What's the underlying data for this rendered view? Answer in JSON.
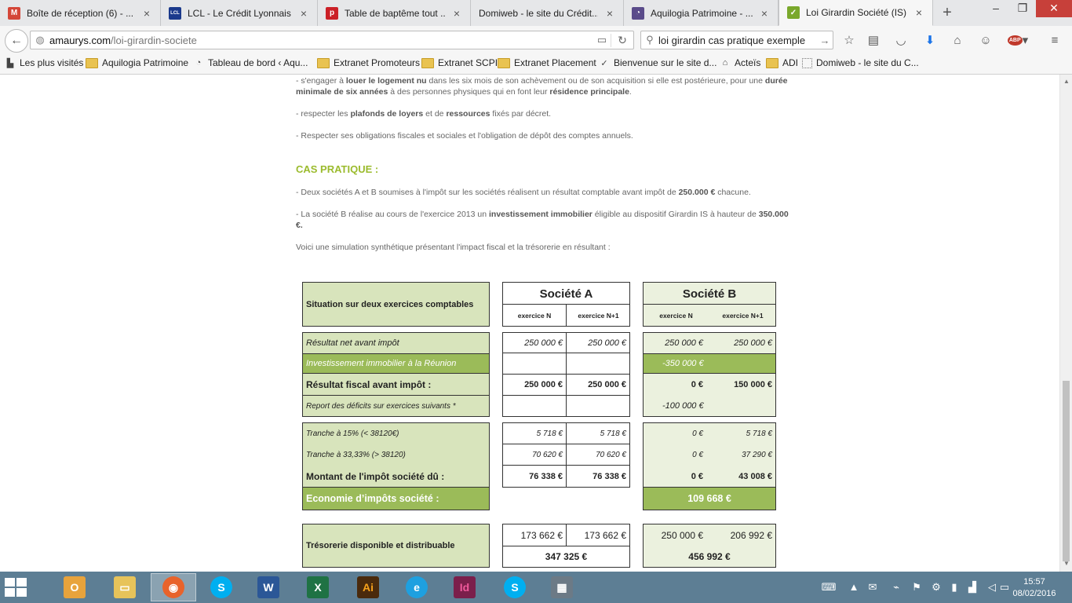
{
  "browser": {
    "tabs": [
      {
        "title": "Boîte de réception (6) - ...",
        "icon": "gmail-icon",
        "color": "#d44638",
        "glyph": "M"
      },
      {
        "title": "LCL - Le Crédit Lyonnais",
        "icon": "lcl-icon",
        "color": "#1b3a8c",
        "glyph": "LCL"
      },
      {
        "title": "Table de baptême tout ...",
        "icon": "pinterest-icon",
        "color": "#cb2027",
        "glyph": "p"
      },
      {
        "title": "Domiweb - le site du Crédit...",
        "icon": "",
        "color": "",
        "glyph": ""
      },
      {
        "title": "Aquilogia Patrimoine - ...",
        "icon": "aquilogia-icon",
        "color": "#5a4b8a",
        "glyph": "◔"
      },
      {
        "title": "Loi Girardin Société (IS)",
        "icon": "leaf-icon",
        "color": "#7aa82b",
        "glyph": "✓"
      }
    ],
    "url_host": "amaurys.com",
    "url_path": "/loi-girardin-societe",
    "search_value": "loi girardin cas pratique exemple",
    "bookmarks": [
      {
        "label": "Les plus visités",
        "icon": "bookmark-icon"
      },
      {
        "label": "Aquilogia Patrimoine",
        "icon": "folder-icon"
      },
      {
        "label": "Tableau de bord ‹ Aqu...",
        "icon": "aquilogia-icon"
      },
      {
        "label": "Extranet Promoteurs",
        "icon": "folder-icon"
      },
      {
        "label": "Extranet SCPI",
        "icon": "folder-icon"
      },
      {
        "label": "Extranet Placement",
        "icon": "folder-icon"
      },
      {
        "label": "Bienvenue sur le site d...",
        "icon": "check-icon"
      },
      {
        "label": "Acteïs",
        "icon": "acteis-icon"
      },
      {
        "label": "ADI",
        "icon": "folder-icon"
      },
      {
        "label": "Domiweb - le site du C...",
        "icon": "page-icon"
      }
    ]
  },
  "article": {
    "para1_pre": "- s'engager à ",
    "para1_b1": "louer le logement nu",
    "para1_mid": " dans les six mois de son achèvement ou de son acquisition si elle est postérieure, pour une ",
    "para1_b2": "durée minimale de six années",
    "para1_mid2": " à des personnes physiques qui en font leur ",
    "para1_b3": "résidence principale",
    "para1_end": ".",
    "para2_pre": "- respecter les ",
    "para2_b1": "plafonds de loyers",
    "para2_mid": " et de ",
    "para2_b2": "ressources",
    "para2_end": " fixés par décret.",
    "para3": "-  Respecter ses obligations fiscales et sociales et l'obligation de dépôt des comptes annuels.",
    "cas_title": "CAS PRATIQUE :",
    "para4_pre": "- Deux sociétés A et B soumises à l'impôt sur les sociétés réalisent un résultat comptable avant impôt de ",
    "para4_b": "250.000 €",
    "para4_end": " chacune.",
    "para5_pre": "- La société B réalise au cours de l'exercice 2013 un ",
    "para5_b1": "investissement immobilier",
    "para5_mid": " éligible au dispositif Girardin IS à hauteur de ",
    "para5_b2": "350.000 €.",
    "para6": "Voici une simulation synthétique présentant l'impact fiscal et la trésorerie en résultant :"
  },
  "table": {
    "header_label": "Situation sur deux exercices comptables",
    "societe_a": "Société A",
    "societe_b": "Société B",
    "ex_n": "exercice N",
    "ex_n1": "exercice N+1",
    "rows": {
      "resultat_net": {
        "label": "Résultat net avant impôt",
        "a_n": "250 000 €",
        "a_n1": "250 000 €",
        "b_n": "250 000 €",
        "b_n1": "250 000 €"
      },
      "investissement": {
        "label": "Investissement immobilier à la Réunion",
        "b": "-350 000 €"
      },
      "resultat_fiscal": {
        "label": "Résultat fiscal avant impôt :",
        "a_n": "250 000 €",
        "a_n1": "250 000 €",
        "b_n": "0 €",
        "b_n1": "150 000 €"
      },
      "report": {
        "label": "Report des déficits sur exercices suivants *",
        "b": "-100 000 €"
      },
      "tranche15": {
        "label": "Tranche à 15% (< 38120€)",
        "a_n": "5 718 €",
        "a_n1": "5 718 €",
        "b_n": "0 €",
        "b_n1": "5 718 €"
      },
      "tranche33": {
        "label": "Tranche à 33,33% (> 38120)",
        "a_n": "70 620 €",
        "a_n1": "70 620 €",
        "b_n": "0 €",
        "b_n1": "37 290 €"
      },
      "montant": {
        "label": "Montant de l'impôt société dû :",
        "a_n": "76 338 €",
        "a_n1": "76 338 €",
        "b_n": "0 €",
        "b_n1": "43 008 €"
      },
      "economie": {
        "label": "Economie d’impôts société :",
        "b": "109 668 €"
      },
      "tresorerie": {
        "label": "Trésorerie disponible et distribuable",
        "a_n": "173 662 €",
        "a_n1": "173 662 €",
        "a_total": "347 325 €",
        "b_n": "250 000 €",
        "b_n1": "206 992 €",
        "b_total": "456 992 €"
      }
    }
  },
  "taskbar": {
    "time": "15:57",
    "date": "08/02/2016",
    "apps": [
      {
        "name": "outlook-icon",
        "glyph": "O",
        "color": "#e8a33c"
      },
      {
        "name": "file-explorer-icon",
        "glyph": "▭",
        "color": "#e7c35a"
      },
      {
        "name": "firefox-icon",
        "glyph": "◉",
        "color": "#e8632b"
      },
      {
        "name": "skype-icon",
        "glyph": "S",
        "color": "#00aff0"
      },
      {
        "name": "word-icon",
        "glyph": "W",
        "color": "#2b5797"
      },
      {
        "name": "excel-icon",
        "glyph": "X",
        "color": "#1f7244"
      },
      {
        "name": "illustrator-icon",
        "glyph": "Ai",
        "color": "#4a2a0c"
      },
      {
        "name": "internet-explorer-icon",
        "glyph": "e",
        "color": "#1ea0e0"
      },
      {
        "name": "indesign-icon",
        "glyph": "Id",
        "color": "#7b1f4b"
      },
      {
        "name": "skype-icon-2",
        "glyph": "S",
        "color": "#00aff0"
      },
      {
        "name": "calculator-icon",
        "glyph": "▦",
        "color": "#6c7a86"
      }
    ]
  }
}
